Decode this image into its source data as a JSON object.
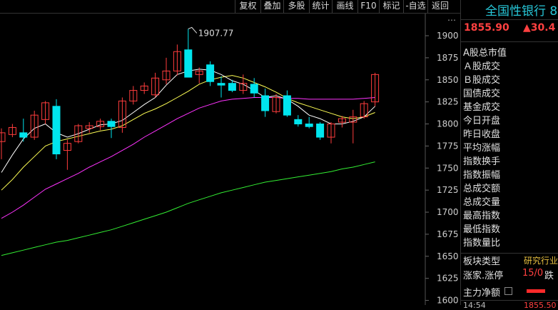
{
  "toolbar": {
    "buttons": [
      "复权",
      "叠加",
      "多股",
      "统计",
      "画线",
      "F10",
      "标记",
      "-自选",
      "返回"
    ]
  },
  "panel": {
    "index_name": "全国性银行 8",
    "price": "1855.90",
    "change": "▲30.4",
    "section_title": "A股总市值",
    "rows": [
      "Ａ股成交",
      "Ｂ股成交",
      "国债成交",
      "基金成交",
      "今日开盘",
      "昨日收盘",
      "平均涨幅",
      "指数换手",
      "指数振幅",
      "总成交额",
      "总成交量",
      "最高指数",
      "最低指数",
      "指数量比"
    ],
    "board_type_label": "板块类型",
    "board_type_value": "研究行业",
    "limit_label": "涨家.涨停",
    "limit_value": "15/0",
    "limit_suffix": "跌",
    "net_flow_label": "主力净额",
    "time_partial": "14:54",
    "price_partial": "1855.50"
  },
  "colors": {
    "up": "#ff3d3d",
    "down": "#00e5ee",
    "ma5": "#ffffff",
    "ma10": "#ffff55",
    "ma20": "#ff33ff",
    "ma60": "#33ee33",
    "axis_text": "#cfcfcf",
    "accent_cyan": "#27c7d8"
  },
  "chart_data": {
    "type": "candlestick",
    "y_ticks": [
      1900,
      1875,
      1850,
      1825,
      1800,
      1775,
      1750,
      1725,
      1700,
      1675,
      1650,
      1625,
      1600
    ],
    "ylim": [
      1600,
      1920
    ],
    "annotation": "1907.77",
    "candles": [
      {
        "o": 1780,
        "h": 1795,
        "l": 1760,
        "c": 1790
      },
      {
        "o": 1788,
        "h": 1800,
        "l": 1785,
        "c": 1796
      },
      {
        "o": 1790,
        "h": 1806,
        "l": 1780,
        "c": 1785
      },
      {
        "o": 1785,
        "h": 1815,
        "l": 1782,
        "c": 1810
      },
      {
        "o": 1805,
        "h": 1826,
        "l": 1800,
        "c": 1824
      },
      {
        "o": 1820,
        "h": 1828,
        "l": 1760,
        "c": 1766
      },
      {
        "o": 1770,
        "h": 1782,
        "l": 1748,
        "c": 1778
      },
      {
        "o": 1780,
        "h": 1800,
        "l": 1778,
        "c": 1798
      },
      {
        "o": 1795,
        "h": 1802,
        "l": 1790,
        "c": 1798
      },
      {
        "o": 1797,
        "h": 1806,
        "l": 1793,
        "c": 1803
      },
      {
        "o": 1803,
        "h": 1806,
        "l": 1784,
        "c": 1797
      },
      {
        "o": 1796,
        "h": 1830,
        "l": 1790,
        "c": 1826
      },
      {
        "o": 1826,
        "h": 1843,
        "l": 1822,
        "c": 1838
      },
      {
        "o": 1838,
        "h": 1847,
        "l": 1834,
        "c": 1843
      },
      {
        "o": 1833,
        "h": 1858,
        "l": 1830,
        "c": 1852
      },
      {
        "o": 1850,
        "h": 1875,
        "l": 1845,
        "c": 1860
      },
      {
        "o": 1860,
        "h": 1890,
        "l": 1855,
        "c": 1882
      },
      {
        "o": 1884,
        "h": 1907.77,
        "l": 1860,
        "c": 1853
      },
      {
        "o": 1856,
        "h": 1864,
        "l": 1846,
        "c": 1860
      },
      {
        "o": 1867,
        "h": 1871,
        "l": 1843,
        "c": 1848
      },
      {
        "o": 1846,
        "h": 1854,
        "l": 1830,
        "c": 1844
      },
      {
        "o": 1846,
        "h": 1850,
        "l": 1836,
        "c": 1838
      },
      {
        "o": 1838,
        "h": 1856,
        "l": 1834,
        "c": 1846
      },
      {
        "o": 1845,
        "h": 1852,
        "l": 1830,
        "c": 1835
      },
      {
        "o": 1832,
        "h": 1840,
        "l": 1808,
        "c": 1815
      },
      {
        "o": 1814,
        "h": 1834,
        "l": 1812,
        "c": 1830
      },
      {
        "o": 1832,
        "h": 1838,
        "l": 1808,
        "c": 1810
      },
      {
        "o": 1805,
        "h": 1810,
        "l": 1797,
        "c": 1800
      },
      {
        "o": 1800,
        "h": 1808,
        "l": 1795,
        "c": 1797
      },
      {
        "o": 1800,
        "h": 1802,
        "l": 1782,
        "c": 1785
      },
      {
        "o": 1785,
        "h": 1802,
        "l": 1778,
        "c": 1800
      },
      {
        "o": 1802,
        "h": 1809,
        "l": 1796,
        "c": 1806
      },
      {
        "o": 1802,
        "h": 1816,
        "l": 1778,
        "c": 1808
      },
      {
        "o": 1808,
        "h": 1826,
        "l": 1806,
        "c": 1823
      },
      {
        "o": 1825,
        "h": 1858,
        "l": 1820,
        "c": 1856
      }
    ],
    "ma5": [
      1745,
      1765,
      1783,
      1795,
      1800,
      1790,
      1785,
      1789,
      1794,
      1799,
      1800,
      1804,
      1813,
      1822,
      1830,
      1844,
      1856,
      1860,
      1862,
      1861,
      1856,
      1849,
      1845,
      1838,
      1830,
      1832,
      1828,
      1820,
      1810,
      1806,
      1800,
      1800,
      1803,
      1808,
      1820
    ],
    "ma10": [
      1725,
      1737,
      1751,
      1763,
      1775,
      1780,
      1783,
      1786,
      1789,
      1792,
      1794,
      1798,
      1805,
      1812,
      1817,
      1823,
      1830,
      1837,
      1845,
      1850,
      1853,
      1855,
      1852,
      1847,
      1842,
      1836,
      1829,
      1824,
      1820,
      1816,
      1812,
      1808,
      1806,
      1808,
      1813
    ],
    "ma20": [
      1693,
      1700,
      1708,
      1717,
      1726,
      1732,
      1738,
      1744,
      1751,
      1757,
      1763,
      1770,
      1777,
      1785,
      1792,
      1799,
      1806,
      1812,
      1818,
      1822,
      1826,
      1828,
      1829,
      1830,
      1830,
      1830,
      1829,
      1829,
      1828,
      1828,
      1828,
      1828,
      1828,
      1829,
      1830
    ],
    "ma60": [
      1651,
      1654,
      1657,
      1660,
      1663,
      1666,
      1668,
      1671,
      1674,
      1677,
      1680,
      1684,
      1688,
      1692,
      1696,
      1700,
      1705,
      1710,
      1714,
      1718,
      1722,
      1725,
      1728,
      1731,
      1734,
      1736,
      1738,
      1740,
      1742,
      1744,
      1746,
      1749,
      1751,
      1754,
      1757
    ]
  }
}
